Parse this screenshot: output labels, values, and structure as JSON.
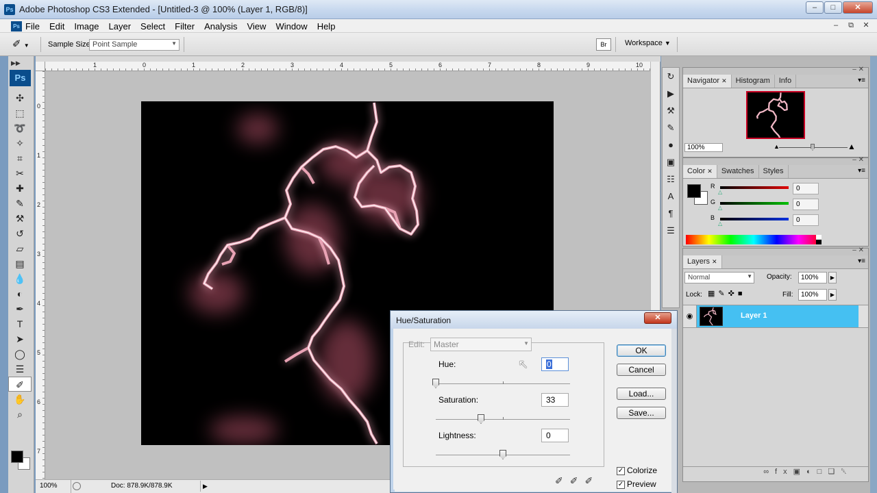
{
  "window": {
    "title": "Adobe Photoshop CS3 Extended - [Untitled-3 @ 100% (Layer 1, RGB/8)]",
    "app_icon": "Ps",
    "controls": [
      "minimize-icon",
      "maximize-icon",
      "close-icon"
    ]
  },
  "menu": {
    "items": [
      "File",
      "Edit",
      "Image",
      "Layer",
      "Select",
      "Filter",
      "Analysis",
      "View",
      "Window",
      "Help"
    ]
  },
  "options": {
    "sample_size_label": "Sample Size:",
    "sample_size_value": "Point Sample",
    "workspace_label": "Workspace"
  },
  "toolbox": {
    "logo": "Ps",
    "tools": [
      "move-tool",
      "marquee-tool",
      "lasso-tool",
      "magic-wand-tool",
      "crop-tool",
      "slice-tool",
      "healing-brush-tool",
      "brush-tool",
      "clone-stamp-tool",
      "history-brush-tool",
      "eraser-tool",
      "gradient-tool",
      "blur-tool",
      "dodge-tool",
      "pen-tool",
      "type-tool",
      "path-selection-tool",
      "shape-tool",
      "notes-tool",
      "eyedropper-tool",
      "hand-tool",
      "zoom-tool"
    ],
    "active_tool": "eyedropper-tool"
  },
  "document": {
    "ruler_h": [
      "1",
      "0",
      "1",
      "2",
      "3",
      "4",
      "5",
      "6",
      "7",
      "8",
      "9",
      "10"
    ],
    "ruler_v": [
      "0",
      "1",
      "2",
      "3",
      "4",
      "5",
      "6",
      "7"
    ],
    "zoom": "100%",
    "doc_size": "Doc: 878.9K/878.9K"
  },
  "navigator": {
    "tabs": [
      "Navigator",
      "Histogram",
      "Info"
    ],
    "zoom": "100%"
  },
  "color": {
    "tabs": [
      "Color",
      "Swatches",
      "Styles"
    ],
    "channels": [
      {
        "label": "R",
        "value": "0",
        "color": "#c00000"
      },
      {
        "label": "G",
        "value": "0",
        "color": "#00a000"
      },
      {
        "label": "B",
        "value": "0",
        "color": "#0020c8"
      }
    ]
  },
  "layers": {
    "tabs": [
      "Layers"
    ],
    "blend_mode": "Normal",
    "opacity_label": "Opacity:",
    "opacity": "100%",
    "lock_label": "Lock:",
    "fill_label": "Fill:",
    "fill": "100%",
    "layer_name": "Layer 1",
    "selected_color": "#45c0f2"
  },
  "hue_sat": {
    "title": "Hue/Saturation",
    "edit_label": "Edit:",
    "edit_value": "Master",
    "hue_label": "Hue:",
    "hue_value": "0",
    "saturation_label": "Saturation:",
    "saturation_value": "33",
    "lightness_label": "Lightness:",
    "lightness_value": "0",
    "buttons": {
      "ok": "OK",
      "cancel": "Cancel",
      "load": "Load...",
      "save": "Save..."
    },
    "colorize_label": "Colorize",
    "colorize_checked": true,
    "preview_label": "Preview",
    "preview_checked": true
  }
}
